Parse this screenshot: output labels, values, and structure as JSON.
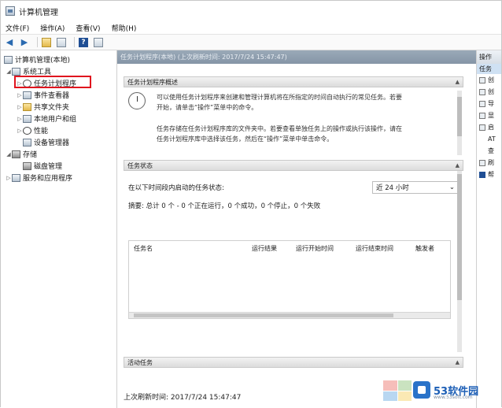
{
  "window": {
    "title": "计算机管理"
  },
  "menu": [
    "文件(F)",
    "操作(A)",
    "查看(V)",
    "帮助(H)"
  ],
  "tree": {
    "root": "计算机管理(本地)",
    "system_tools": "系统工具",
    "task_scheduler": "任务计划程序",
    "event_viewer": "事件查看器",
    "shared_folders": "共享文件夹",
    "local_users": "本地用户和组",
    "performance": "性能",
    "device_manager": "设备管理器",
    "storage": "存储",
    "disk_management": "磁盘管理",
    "services": "服务和应用程序"
  },
  "center": {
    "header": "任务计划程序(本地) (上次刷新时间: 2017/7/24 15:47:47)",
    "overview_title": "任务计划程序概述",
    "overview_p1_l1": "可以使用任务计划程序来创建和管理计算机将在所指定的时间自动执行的常见任务。若要",
    "overview_p1_l2": "开始，请单击“操作”菜单中的命令。",
    "overview_p2_l1": "任务存储在任务计划程序库的文件夹中。若要查看单独任务上的操作或执行该操作，请在",
    "overview_p2_l2": "任务计划程序库中选择该任务，然后在“操作”菜单中单击命令。",
    "status_title": "任务状态",
    "range_label": "在以下时间段内启动的任务状态:",
    "range_value": "近 24 小时",
    "summary": "摘要: 总计 0 个 - 0 个正在运行，0 个成功，0 个停止，0 个失败",
    "columns": [
      "任务名",
      "运行结果",
      "运行开始时间",
      "运行结束时间",
      "触发者"
    ],
    "active_title": "活动任务",
    "footer": "上次刷新时间: 2017/7/24 15:47:47"
  },
  "actions": {
    "header": "操作",
    "sub": "任务",
    "items": [
      "创",
      "创",
      "导",
      "显",
      "启",
      "AT",
      "查",
      "刷",
      "帮"
    ]
  },
  "watermark": {
    "brand": "53软件园",
    "url": "www.53soft.com"
  }
}
